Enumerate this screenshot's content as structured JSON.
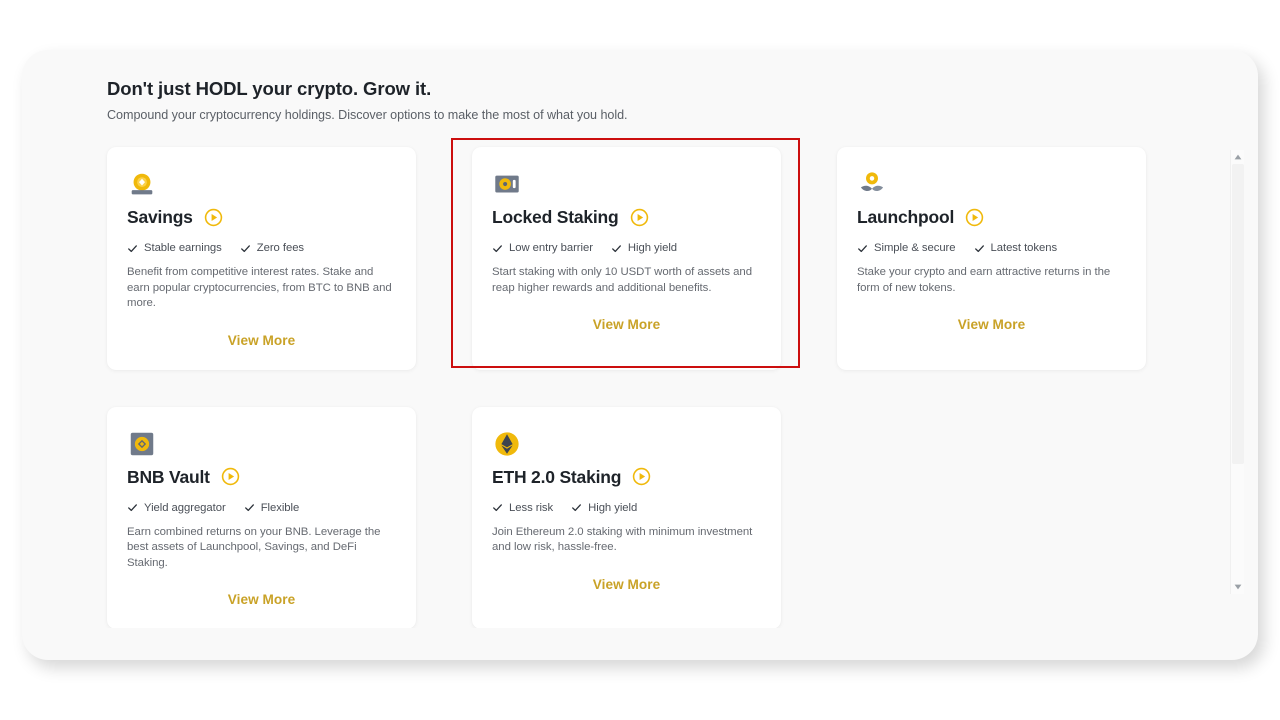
{
  "header": {
    "title": "Don't just HODL your crypto. Grow it.",
    "subtitle": "Compound your cryptocurrency holdings. Discover options to make the most of what you hold."
  },
  "colors": {
    "accent_yellow": "#f0b90b",
    "link_gold": "#c9a227",
    "highlight_red": "#cc0e0e",
    "panel_bg": "#f9f9f9",
    "card_bg": "#ffffff",
    "title_text": "#1e2329",
    "body_text": "#666a71"
  },
  "common": {
    "view_more_label": "View More",
    "play_icon": "play-circle-icon",
    "check_icon": "check-icon"
  },
  "cards": [
    {
      "id": "savings",
      "icon": "savings-coin-icon",
      "title": "Savings",
      "features": [
        "Stable earnings",
        "Zero fees"
      ],
      "description": "Benefit from competitive interest rates. Stake and earn popular cryptocurrencies, from BTC to BNB and more.",
      "view_more_label": "View More",
      "highlighted": false
    },
    {
      "id": "locked-staking",
      "icon": "vault-safe-icon",
      "title": "Locked Staking",
      "features": [
        "Low entry barrier",
        "High yield"
      ],
      "description": "Start staking with only 10 USDT worth of assets and reap higher rewards and additional benefits.",
      "view_more_label": "View More",
      "highlighted": true
    },
    {
      "id": "launchpool",
      "icon": "launchpool-sprout-icon",
      "title": "Launchpool",
      "features": [
        "Simple & secure",
        "Latest tokens"
      ],
      "description": "Stake your crypto and earn attractive returns in the form of new tokens.",
      "view_more_label": "View More",
      "highlighted": false
    },
    {
      "id": "bnb-vault",
      "icon": "bnb-vault-icon",
      "title": "BNB Vault",
      "features": [
        "Yield aggregator",
        "Flexible"
      ],
      "description": "Earn combined returns on your BNB. Leverage the best assets of Launchpool, Savings, and DeFi Staking.",
      "view_more_label": "View More",
      "highlighted": false
    },
    {
      "id": "eth2-staking",
      "icon": "ethereum-coin-icon",
      "title": "ETH 2.0 Staking",
      "features": [
        "Less risk",
        "High yield"
      ],
      "description": "Join Ethereum 2.0 staking with minimum investment and low risk, hassle-free.",
      "view_more_label": "View More",
      "highlighted": false
    }
  ],
  "scrollbar": {
    "up_arrow": "scroll-up-arrow-icon",
    "down_arrow": "scroll-down-arrow-icon"
  }
}
